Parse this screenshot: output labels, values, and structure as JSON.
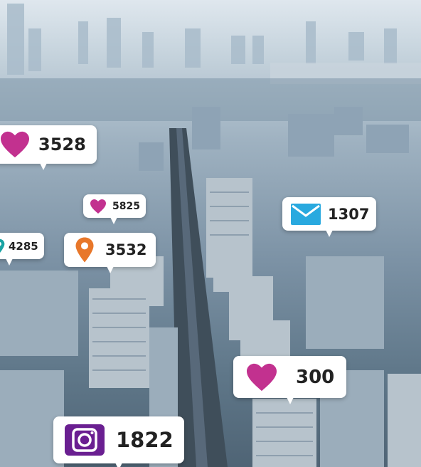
{
  "notifications": [
    {
      "icon": "heart-icon",
      "count": "3528",
      "color": "#c2318f"
    },
    {
      "icon": "heart-icon",
      "count": "5825",
      "color": "#c2318f"
    },
    {
      "icon": "location-pin-icon",
      "count": "4285",
      "color": "#1aa3a3"
    },
    {
      "icon": "location-pin-icon",
      "count": "3532",
      "color": "#e8772a"
    },
    {
      "icon": "mail-icon",
      "count": "1307",
      "color": "#29a9df"
    },
    {
      "icon": "heart-icon",
      "count": "300",
      "color": "#c2318f"
    },
    {
      "icon": "camera-icon",
      "count": "1822",
      "color": "#6a1f91"
    }
  ]
}
